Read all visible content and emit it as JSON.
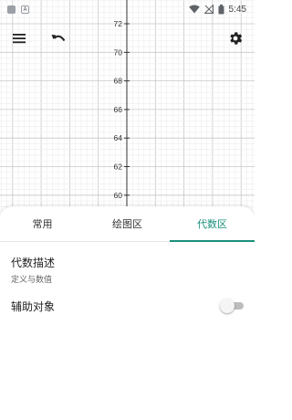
{
  "status_bar": {
    "time": "5:45"
  },
  "graph": {
    "y_ticks": [
      "72",
      "70",
      "68",
      "66",
      "64",
      "62",
      "60"
    ]
  },
  "toolbar": {
    "menu_icon": "hamburger-menu-icon",
    "undo_icon": "undo-icon",
    "settings_icon": "gear-icon"
  },
  "tabs": [
    {
      "label": "常用",
      "active": false
    },
    {
      "label": "绘图区",
      "active": false
    },
    {
      "label": "代数区",
      "active": true
    }
  ],
  "algebra": {
    "description_title": "代数描述",
    "description_sub": "定义与数值",
    "auxiliary_label": "辅助对象",
    "auxiliary_enabled": false
  },
  "colors": {
    "accent": "#1a8f7a",
    "grid_major": "#c8c8c8",
    "grid_minor": "#ececec"
  }
}
